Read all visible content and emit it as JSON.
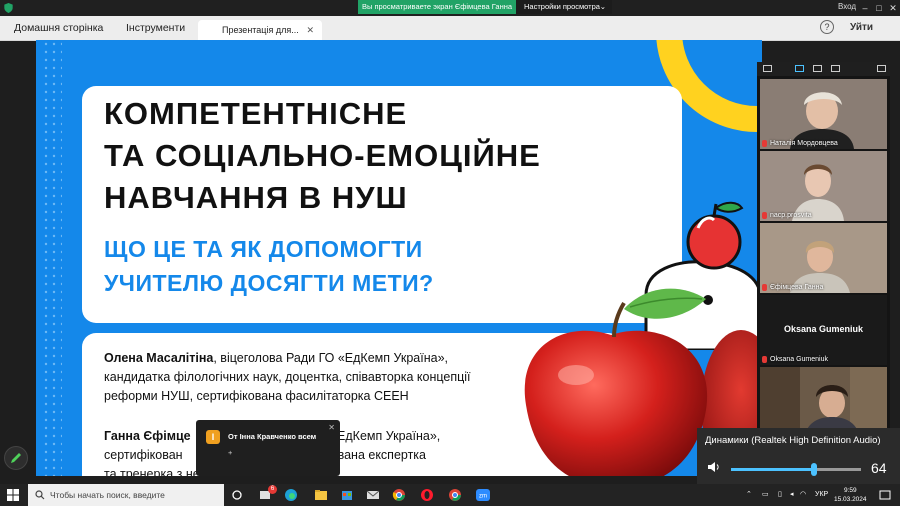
{
  "share_bar": {
    "viewing_text": "Вы просматриваете экран Єфімцева Ганна",
    "settings_label": "Настройки просмотра",
    "login_label": "Вход"
  },
  "tabs": {
    "home": "Домашня сторінка",
    "tools": "Інструменти",
    "active_tab": "Презентація для...",
    "exit": "Уйти"
  },
  "slide": {
    "title_lines": [
      "КОМПЕТЕНТНІСНЕ",
      "ТА СОЦІАЛЬНО-ЕМОЦІЙНЕ",
      "НАВЧАННЯ В НУШ"
    ],
    "subtitle_lines": [
      "ЩО ЦЕ ТА ЯК ДОПОМОГТИ",
      "УЧИТЕЛЮ ДОСЯГТИ МЕТИ?"
    ],
    "speaker1_name": "Олена Масалітіна",
    "speaker1_desc_1": ", віцеголова Ради ГО «ЕдКемп Україна»,",
    "speaker1_desc_2": "кандидатка філологічних наук, доцентка, співавторка концепції",
    "speaker1_desc_3": "реформи НУШ, сертифікована фасилітаторка СЕЕН",
    "speaker2_name": "Ганна Єфімце",
    "speaker2_desc_1": "я ГО «ЕдКемп Україна»,",
    "speaker2_desc_2": "сертифікован",
    "speaker2_desc_2b": "ртифікована експертка",
    "speaker2_desc_3": "та тренерка з неформальної освіти"
  },
  "participants": [
    {
      "name": "Наталія Мордовцева",
      "bg": "#7a6a5e"
    },
    {
      "name": "nacp.prosvita",
      "bg": "#9a8a82"
    },
    {
      "name": "Єфімцева Ганна",
      "bg": "#8e8072"
    },
    {
      "name": "Oksana Gumeniuk",
      "bg": "#1a1a1a",
      "center_label": "Oksana Gumeniuk"
    },
    {
      "name": "",
      "bg": "#6b5a48"
    }
  ],
  "audio": {
    "device": "Динамики (Realtek High Definition Audio)",
    "volume": 64,
    "volume_fraction": 0.64
  },
  "chat_toast": {
    "avatar_letter": "І",
    "from": "От Інна Кравченко всем",
    "message": "+"
  },
  "taskbar": {
    "search_placeholder": "Чтобы начать поиск, введите",
    "language": "УКР",
    "time": "9:59",
    "date": "15.03.2024",
    "badge": "6"
  },
  "colors": {
    "slide_blue": "#1488ea",
    "accent_yellow": "#ffd21f",
    "zoom_green": "#21a366",
    "slider_blue": "#4cc2ff"
  }
}
